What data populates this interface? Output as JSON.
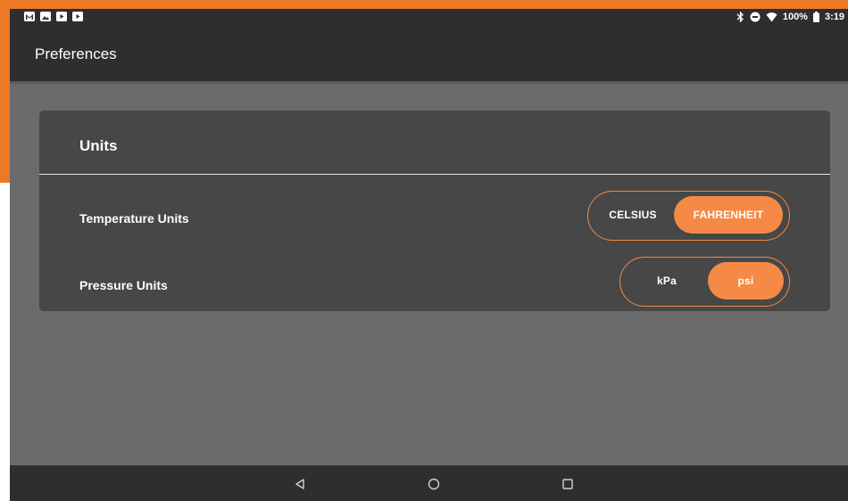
{
  "status_bar": {
    "battery": "100%",
    "time": "3:19",
    "notification_icons": [
      "gmail-icon",
      "image-icon",
      "youtube-icon",
      "youtube-icon"
    ],
    "system_icons": [
      "bluetooth-icon",
      "do-not-disturb-icon",
      "wifi-icon",
      "battery-icon"
    ]
  },
  "app_bar": {
    "title": "Preferences"
  },
  "units_card": {
    "title": "Units",
    "temperature": {
      "label": "Temperature Units",
      "options": [
        "CELSIUS",
        "FAHRENHEIT"
      ],
      "selected": "FAHRENHEIT"
    },
    "pressure": {
      "label": "Pressure Units",
      "options": [
        "kPa",
        "psi"
      ],
      "selected": "psi"
    }
  },
  "nav_bar": {
    "buttons": [
      "back-icon",
      "home-icon",
      "recents-icon"
    ]
  },
  "colors": {
    "accent": "#f48a45",
    "app_bar": "#2e2e2e",
    "card": "#474747",
    "background": "#6b6b6b",
    "frame_orange": "#ea7a25"
  }
}
